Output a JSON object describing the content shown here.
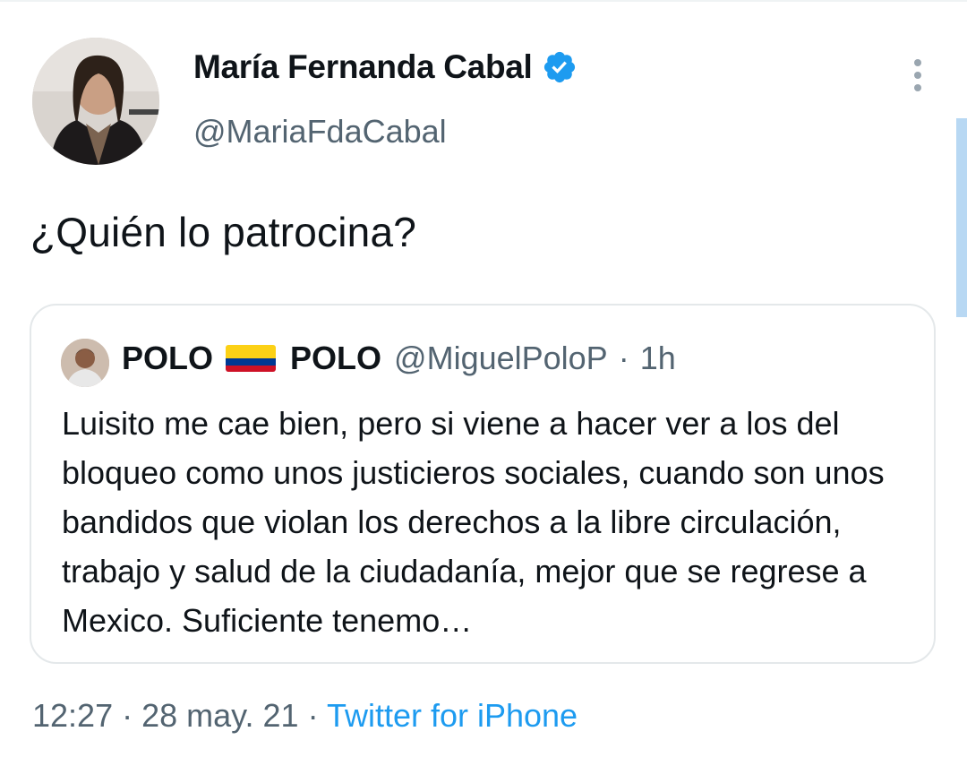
{
  "tweet": {
    "author_name": "María Fernanda Cabal",
    "author_handle": "@MariaFdaCabal",
    "text": "¿Quién lo patrocina?",
    "time": "12:27",
    "date": "28 may. 21",
    "source": "Twitter for iPhone",
    "separator": "·"
  },
  "quoted": {
    "name_part1": "POLO",
    "name_part2": "POLO",
    "handle": "@MiguelPoloP",
    "separator": "·",
    "time": "1h",
    "text": "Luisito me cae bien, pero si viene a hacer ver a los del bloqueo como unos justicieros sociales, cuando son unos bandidos que violan los derechos a la libre circulación, trabajo y salud de la ciudadanía, mejor que se regrese a Mexico. Suficiente tenemo…"
  },
  "colors": {
    "accent": "#1d9bf0",
    "muted": "#536471",
    "text": "#0f1419",
    "border": "#e4e8ea",
    "flag_yellow": "#fcd116",
    "flag_blue": "#003893",
    "flag_red": "#ce1126"
  },
  "icons": {
    "verified": "verified-badge-icon",
    "more": "more-options-icon",
    "flag": "colombia-flag-icon"
  }
}
